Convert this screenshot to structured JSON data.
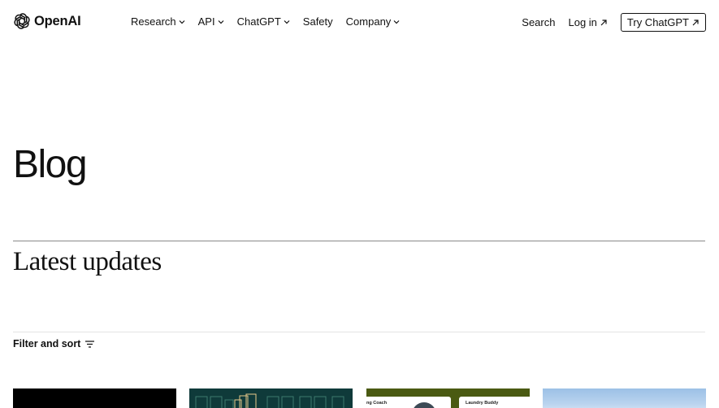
{
  "brand": {
    "name": "OpenAI"
  },
  "nav": {
    "items": [
      {
        "label": "Research",
        "dropdown": true
      },
      {
        "label": "API",
        "dropdown": true
      },
      {
        "label": "ChatGPT",
        "dropdown": true
      },
      {
        "label": "Safety",
        "dropdown": false
      },
      {
        "label": "Company",
        "dropdown": true
      }
    ],
    "search_label": "Search",
    "login_label": "Log in",
    "try_label": "Try ChatGPT"
  },
  "main": {
    "page_title": "Blog",
    "section_title": "Latest updates",
    "filter_label": "Filter and sort"
  },
  "cards": [
    {
      "color": "#000000"
    },
    {
      "color": "#0f3a3a"
    },
    {
      "color": "#4a5a12",
      "labels": [
        "ng Coach",
        "Laundry Buddy"
      ]
    },
    {
      "color": "#9cc0e6"
    }
  ]
}
